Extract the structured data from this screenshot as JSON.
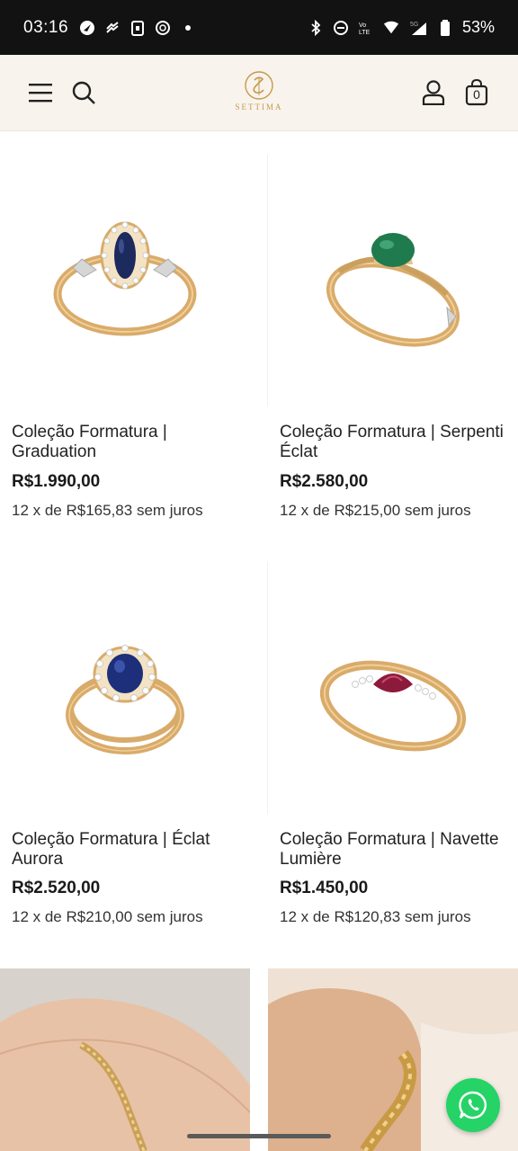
{
  "status_bar": {
    "time": "03:16",
    "battery": "53%",
    "network_label": "5G"
  },
  "header": {
    "brand": "SETTIMA",
    "cart_count": "0",
    "icons": [
      "menu-icon",
      "search-icon",
      "user-icon",
      "bag-icon"
    ]
  },
  "products": [
    {
      "name": "Coleção Formatura | Graduation",
      "price": "R$1.990,00",
      "installments": "12 x de R$165,83 sem juros",
      "stone_color": "#1c2a5e"
    },
    {
      "name": "Coleção Formatura | Serpenti Éclat",
      "price": "R$2.580,00",
      "installments": "12 x de R$215,00 sem juros",
      "stone_color": "#1f7a4d"
    },
    {
      "name": "Coleção Formatura | Éclat Aurora",
      "price": "R$2.520,00",
      "installments": "12 x de R$210,00 sem juros",
      "stone_color": "#1d2f7a"
    },
    {
      "name": "Coleção Formatura | Navette Lumière",
      "price": "R$1.450,00",
      "installments": "12 x de R$120,83 sem juros",
      "stone_color": "#8c1a3a"
    }
  ],
  "colors": {
    "gold": "#d9ab6a",
    "header_bg": "#f8f3ec",
    "whatsapp": "#25d366"
  }
}
